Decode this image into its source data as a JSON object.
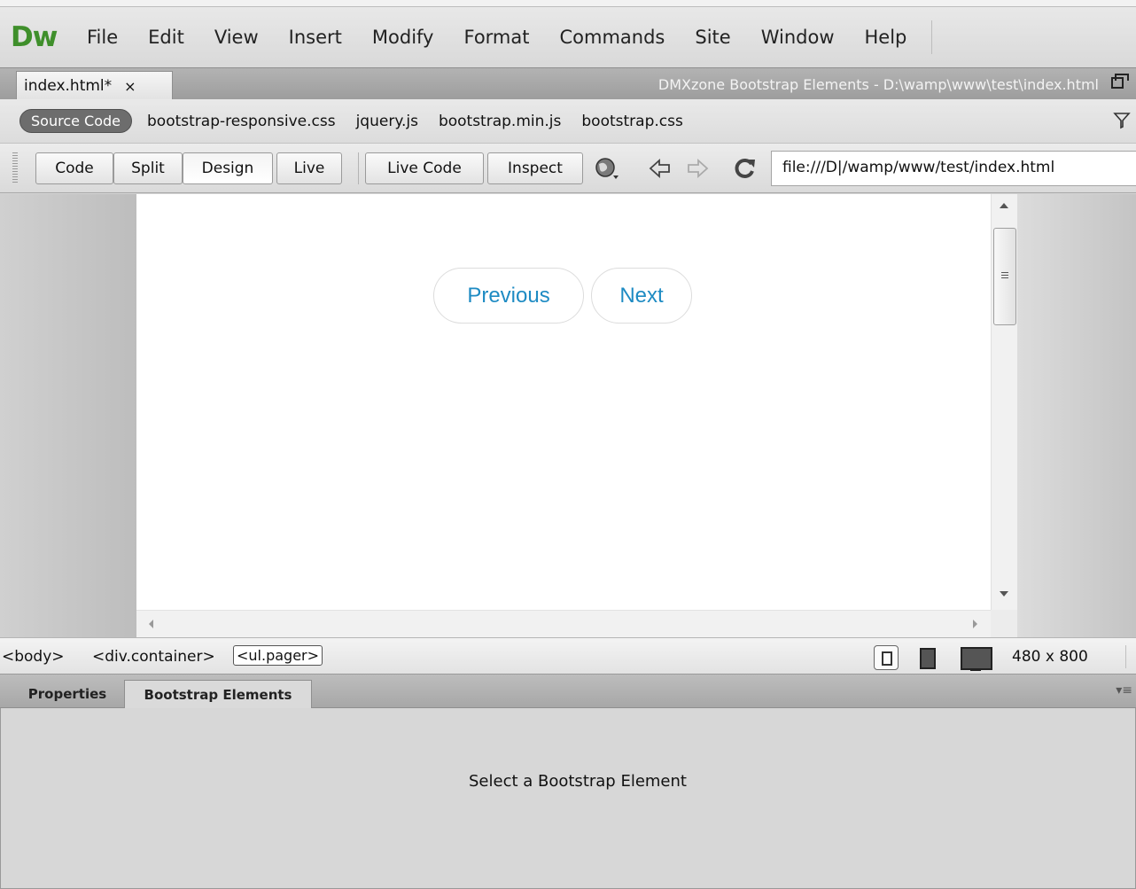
{
  "app": {
    "logo": "Dw",
    "menu": [
      "File",
      "Edit",
      "View",
      "Insert",
      "Modify",
      "Format",
      "Commands",
      "Site",
      "Window",
      "Help"
    ]
  },
  "document_tab": {
    "label": "index.html*",
    "close": "×",
    "window_title": "DMXzone Bootstrap Elements - D:\\wamp\\www\\test\\index.html"
  },
  "related_files": {
    "source_code": "Source Code",
    "files": [
      "bootstrap-responsive.css",
      "jquery.js",
      "bootstrap.min.js",
      "bootstrap.css"
    ]
  },
  "toolbar": {
    "code": "Code",
    "split": "Split",
    "design": "Design",
    "live": "Live",
    "live_code": "Live Code",
    "inspect": "Inspect",
    "address": "file:///D|/wamp/www/test/index.html"
  },
  "canvas": {
    "pager": {
      "previous": "Previous",
      "next": "Next"
    },
    "link_color": "#1e8bc3"
  },
  "status": {
    "tags": [
      "<body>",
      "<div.container>",
      "<ul.pager>"
    ],
    "window_size": "480 x 800"
  },
  "panel": {
    "tabs": [
      "Properties",
      "Bootstrap Elements"
    ],
    "active_tab": "Bootstrap Elements",
    "message": "Select a Bootstrap Element"
  },
  "icons": {
    "browser_preview": "globe-icon",
    "back": "back-arrow-icon",
    "forward": "forward-arrow-icon",
    "refresh": "refresh-icon",
    "filter": "filter-icon"
  }
}
